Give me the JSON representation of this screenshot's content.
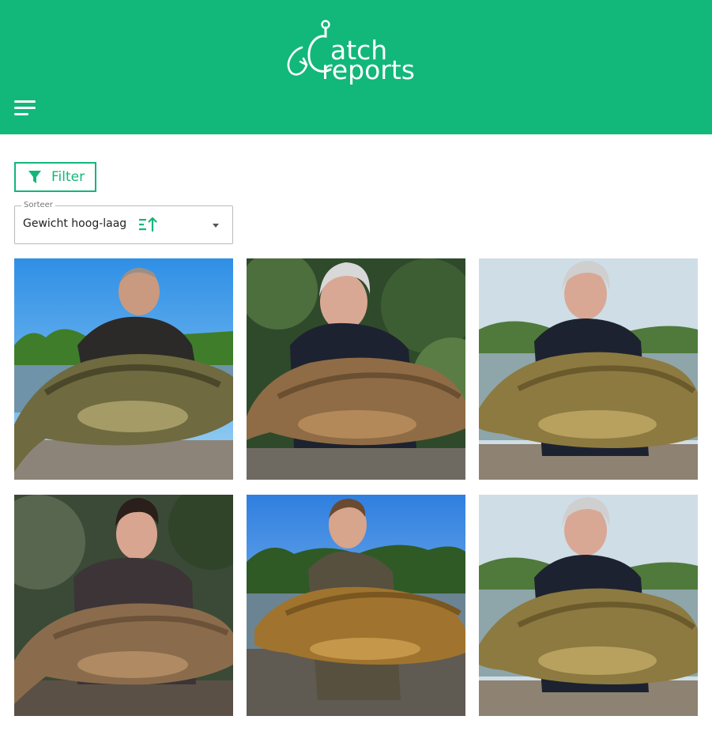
{
  "header": {
    "logo_line1": "atch",
    "logo_line2": "reports",
    "logo_text": "Catch reports",
    "bg_color": "#12b77a"
  },
  "menu": {
    "icon": "hamburger-menu-icon"
  },
  "filter": {
    "label": "Filter",
    "icon": "funnel-icon"
  },
  "sort": {
    "legend": "Sorteer",
    "selected": "Gewicht hoog-laag",
    "icon": "sort-descending-icon"
  },
  "catches": [
    {
      "icon": "catch-photo-mirror-carp",
      "theme": "lake-sky"
    },
    {
      "icon": "catch-photo-common-carp",
      "theme": "forest"
    },
    {
      "icon": "catch-photo-common-carp",
      "theme": "lake-cloudy"
    },
    {
      "icon": "catch-photo-mirror-carp",
      "theme": "forest-dark"
    },
    {
      "icon": "catch-photo-mirror-carp",
      "theme": "lake-sky"
    },
    {
      "icon": "catch-photo-common-carp",
      "theme": "lake-cloudy"
    }
  ]
}
